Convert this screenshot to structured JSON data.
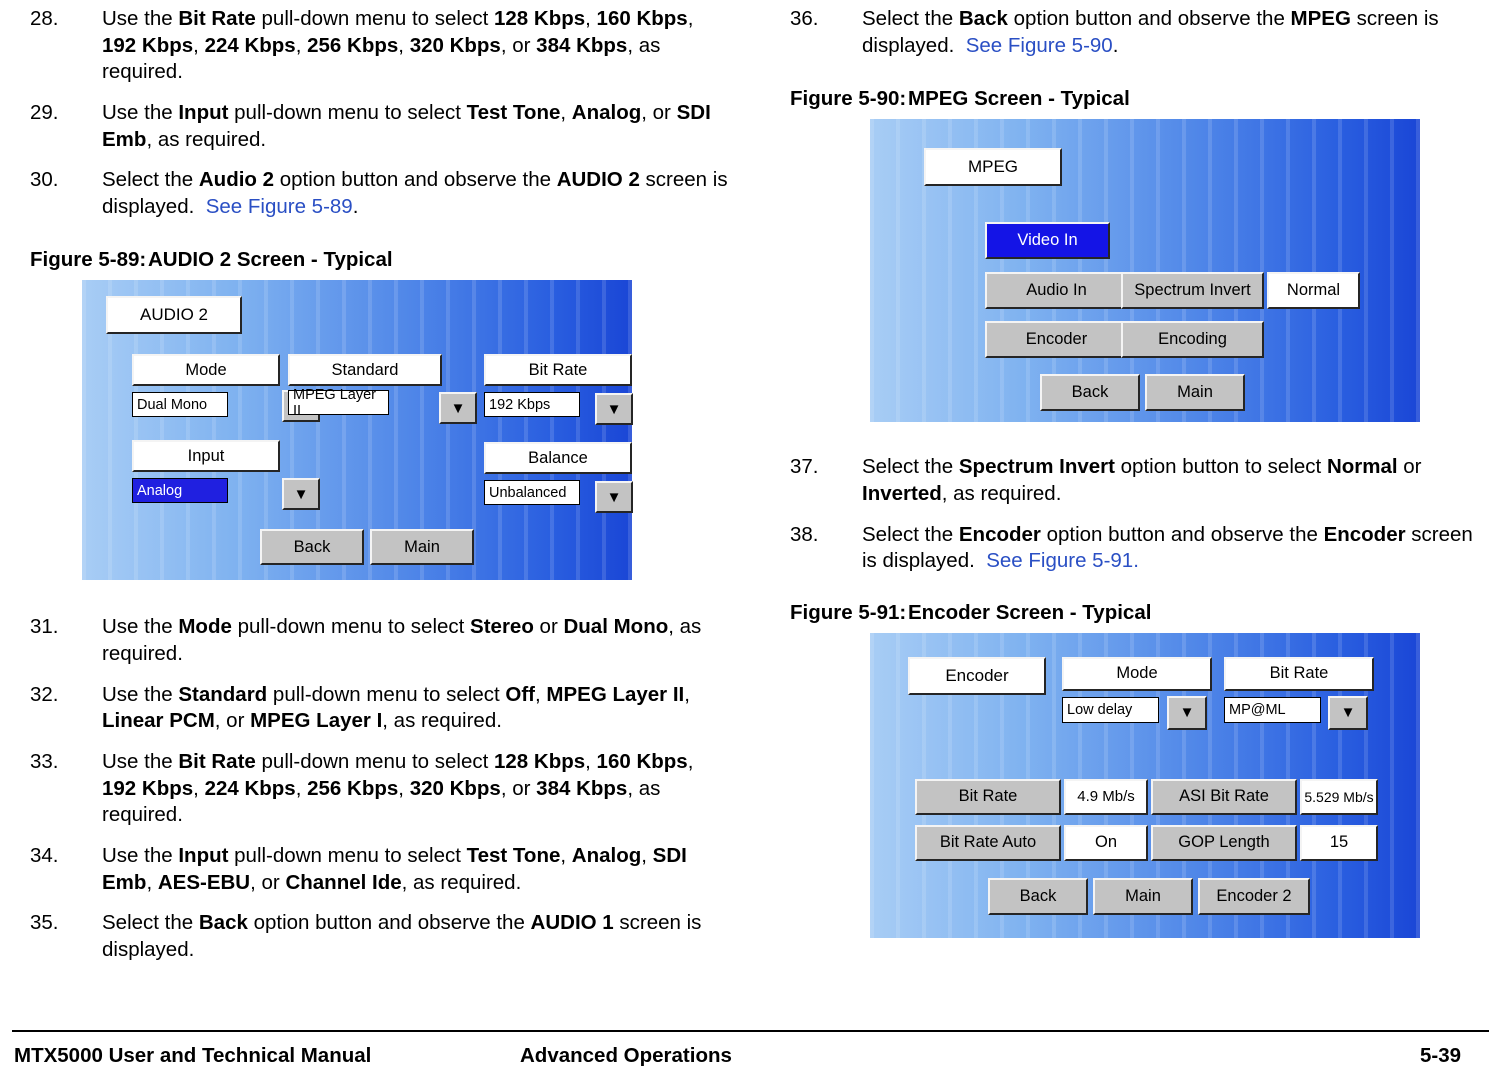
{
  "left_steps": [
    {
      "num": "28.",
      "html": "Use the <b>Bit Rate</b> pull-down menu to select <b>128 Kbps</b>, <b>160 Kbps</b>, <b>192 Kbps</b>, <b>224 Kbps</b>, <b>256 Kbps</b>, <b>320 Kbps</b>, or <b>384 Kbps</b>, as required."
    },
    {
      "num": "29.",
      "html": "Use the <b>Input</b> pull-down menu to select <b>Test Tone</b>, <b>Analog</b>, or <b>SDI Emb</b>, as required."
    },
    {
      "num": "30.",
      "html": "Select the <b>Audio 2</b> option button and observe the <b>AUDIO 2</b> screen is displayed.&nbsp; <span class=\"xref\">See Figure 5-89</span>."
    }
  ],
  "left_steps_2": [
    {
      "num": "31.",
      "html": "Use the <b>Mode</b> pull-down menu to select <b>Stereo</b> or <b>Dual Mono</b>, as required."
    },
    {
      "num": "32.",
      "html": "Use the <b>Standard</b> pull-down menu to select <b>Off</b>, <b>MPEG Layer II</b>, <b>Linear PCM</b>, or <b>MPEG Layer I</b>, as required."
    },
    {
      "num": "33.",
      "html": "Use the <b>Bit Rate</b> pull-down menu to select <b>128 Kbps</b>, <b>160 Kbps</b>, <b>192 Kbps</b>, <b>224 Kbps</b>, <b>256 Kbps</b>, <b>320 Kbps</b>, or <b>384 Kbps</b>, as required."
    },
    {
      "num": "34.",
      "html": "Use the <b>Input</b> pull-down menu to select <b>Test Tone</b>, <b>Analog</b>, <b>SDI Emb</b>, <b>AES-EBU</b>, or <b>Channel Ide</b>, as required."
    },
    {
      "num": "35.",
      "html": "Select the <b>Back</b> option button and observe the <b>AUDIO 1</b> screen is displayed."
    }
  ],
  "right_steps": [
    {
      "num": "36.",
      "html": "Select the <b>Back</b> option button and observe the <b>MPEG</b> screen is displayed.&nbsp; <span class=\"xref\">See Figure 5-90</span>."
    }
  ],
  "right_steps_2": [
    {
      "num": "37.",
      "html": "Select the <b>Spectrum Invert</b> option button to select <b>Normal</b> or <b>Inverted</b>, as required."
    },
    {
      "num": "38.",
      "html": "Select the <b>Encoder</b> option button and observe the <b>Encoder</b> screen is displayed.&nbsp; <span class=\"xref\">See Figure 5-91.</span>"
    }
  ],
  "figures": {
    "fig589": {
      "label": "Figure 5-89:",
      "title": "AUDIO 2 Screen - Typical"
    },
    "fig590": {
      "label": "Figure 5-90:",
      "title": "MPEG Screen - Typical"
    },
    "fig591": {
      "label": "Figure 5-91:",
      "title": "Encoder Screen - Typical"
    }
  },
  "screen589": {
    "title": "AUDIO 2",
    "mode_label": "Mode",
    "mode_value": "Dual Mono",
    "standard_label": "Standard",
    "standard_value": "MPEG Layer II",
    "bitrate_label": "Bit Rate",
    "bitrate_value": "192 Kbps",
    "input_label": "Input",
    "input_value": "Analog",
    "balance_label": "Balance",
    "balance_value": "Unbalanced",
    "back": "Back",
    "main": "Main"
  },
  "screen590": {
    "title": "MPEG",
    "video_in": "Video In",
    "audio_in": "Audio In",
    "spectrum_invert": "Spectrum Invert",
    "normal": "Normal",
    "encoder": "Encoder",
    "encoding": "Encoding",
    "back": "Back",
    "main": "Main"
  },
  "screen591": {
    "title": "Encoder",
    "mode_label": "Mode",
    "mode_value": "Low delay",
    "bitrate_label": "Bit Rate",
    "bitrate_value": "MP@ML",
    "bitrate2_label": "Bit Rate",
    "bitrate2_value": "4.9 Mb/s",
    "asi_label": "ASI Bit Rate",
    "asi_value": "5.529 Mb/s",
    "bitrate_auto_label": "Bit Rate Auto",
    "bitrate_auto_value": "On",
    "gop_label": "GOP Length",
    "gop_value": "15",
    "back": "Back",
    "main": "Main",
    "encoder2": "Encoder 2"
  },
  "footer": {
    "left": "MTX5000 User and Technical Manual",
    "center": "Advanced Operations",
    "right": "5-39"
  }
}
